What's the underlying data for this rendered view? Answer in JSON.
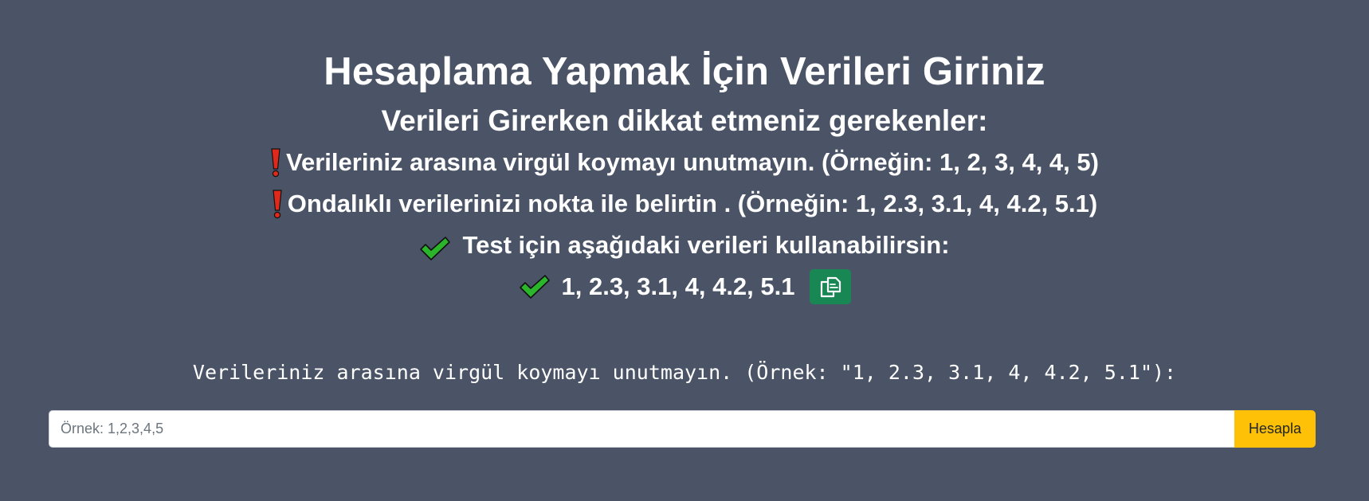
{
  "page": {
    "title": "Hesaplama Yapmak İçin Verileri Giriniz"
  },
  "notes": {
    "heading": "Verileri Girerken dikkat etmeniz gerekenler:",
    "warning_1": "Verileriniz arasına virgül koymayı unutmayın. (Örneğin: 1, 2, 3, 4, 4, 5)",
    "warning_2": "Ondalıklı verilerinizi nokta ile belirtin . (Örneğin: 1, 2.3, 3.1, 4, 4.2, 5.1)",
    "test_hint": "Test için aşağıdaki verileri kullanabilirsin:",
    "sample_data": "1, 2.3, 3.1, 4, 4.2, 5.1",
    "warning_icon": "exclamation-icon",
    "check_icon": "check-mark-icon",
    "copy_icon": "copy-icon"
  },
  "form": {
    "label": "Verileriniz arasına virgül koymayı unutmayın. (Örnek: \"1, 2.3, 3.1, 4, 4.2, 5.1\"):",
    "input_value": "",
    "input_placeholder": "Örnek: 1,2,3,4,5",
    "submit_label": "Hesapla"
  },
  "colors": {
    "background": "#4a5466",
    "warning": "#e0291b",
    "check": "#2ab52a",
    "copy_button": "#198754",
    "submit_button": "#ffc107"
  }
}
